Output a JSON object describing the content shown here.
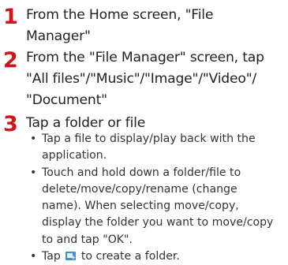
{
  "steps": [
    {
      "number": "1",
      "lines": [
        "From the Home screen, \"File",
        "Manager\""
      ]
    },
    {
      "number": "2",
      "lines": [
        "From the \"File Manager\" screen, tap",
        "\"All files\"/\"Music\"/\"Image\"/\"Video\"/",
        "\"Document\""
      ]
    },
    {
      "number": "3",
      "lines": [
        "Tap a folder or file"
      ]
    }
  ],
  "bullets": [
    {
      "marker": "•",
      "lines": [
        "Tap a file to display/play back with the",
        "application."
      ]
    },
    {
      "marker": "•",
      "lines": [
        "Touch and hold down a folder/file to",
        "delete/move/copy/rename (change",
        "name). When selecting move/copy,",
        "display the folder you want to move/copy",
        "to and tap \"OK\"."
      ]
    },
    {
      "marker": "•",
      "text_before_icon": "Tap",
      "icon": "new-folder-icon",
      "text_after_icon": "to create a folder."
    }
  ]
}
